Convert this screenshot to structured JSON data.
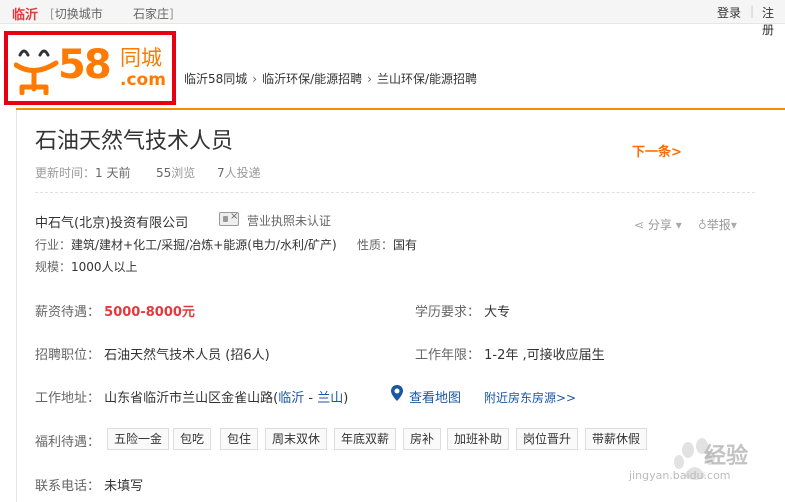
{
  "topbar": {
    "city": "临沂",
    "switch_label": "切换城市",
    "alt_city": "石家庄",
    "login": "登录",
    "separator": "|",
    "register": "注册"
  },
  "logo": {
    "number": "58",
    "name": "同城",
    "domain": ".com"
  },
  "breadcrumb": [
    "临沂58同城",
    "临沂环保/能源招聘",
    "兰山环保/能源招聘"
  ],
  "job": {
    "title": "石油天然气技术人员",
    "next": "下一条>",
    "updated_label": "更新时间：",
    "updated_value": "1 天前",
    "views_value": "55",
    "views_label": "浏览",
    "applicants_value": "7",
    "applicants_label": "人投递"
  },
  "company": {
    "name": "中石气(北京)投资有限公司",
    "license": "营业执照未认证",
    "share": "分享",
    "report": "举报",
    "industry_label": "行业：",
    "industry_value": "建筑/建材+化工/采掘/冶炼+能源(电力/水利/矿产)",
    "nature_label": "性质：",
    "nature_value": "国有",
    "scale_label": "规模：",
    "scale_value": "1000人以上"
  },
  "details": {
    "salary_label": "薪资待遇：",
    "salary_value": "5000-8000元",
    "education_label": "学历要求：",
    "education_value": "大专",
    "position_label": "招聘职位：",
    "position_value": "石油天然气技术人员 (招6人)",
    "experience_label": "工作年限：",
    "experience_value": "1-2年 ,可接收应届生",
    "address_label": "工作地址：",
    "address_value": "山东省临沂市兰山区金雀山路",
    "area_open": "(",
    "area_city": "临沂",
    "area_dash": " - ",
    "area_district": "兰山",
    "area_close": ")",
    "map_link": "查看地图",
    "near_link": "附近房东房源>>",
    "benefits_label": "福利待遇：",
    "benefits": [
      "五险一金",
      "包吃",
      "包住",
      "周末双休",
      "年底双薪",
      "房补",
      "加班补助",
      "岗位晋升",
      "带薪休假"
    ],
    "phone_label": "联系电话：",
    "phone_value": "未填写"
  },
  "watermark": {
    "brand": "经验",
    "url": "jingyan.baidu.com"
  },
  "colors": {
    "accent": "#ff8a00",
    "logo_orange": "#ff7a00",
    "logo_border": "#e60012",
    "salary_red": "#e4393c",
    "link_blue": "#1a56a6"
  }
}
